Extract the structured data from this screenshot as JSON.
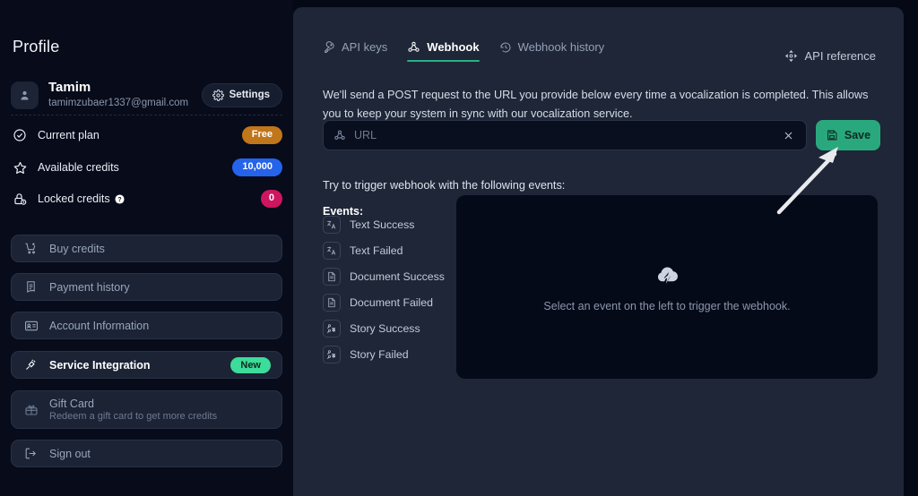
{
  "sidebar": {
    "title": "Profile",
    "user": {
      "name": "Tamim",
      "email": "tamimzubaer1337@gmail.com",
      "avatar_icon": "user-icon"
    },
    "settings_button": {
      "label": "Settings",
      "icon": "gear-icon"
    },
    "stats": [
      {
        "label": "Current plan",
        "icon": "check-circle-icon",
        "value": "Free",
        "badge_color": "#c0761a",
        "help": false
      },
      {
        "label": "Available credits",
        "icon": "star-icon",
        "value": "10,000",
        "badge_color": "#2563eb",
        "help": false
      },
      {
        "label": "Locked credits",
        "icon": "lock-clock-icon",
        "value": "0",
        "badge_color": "#cf1560",
        "help": true
      }
    ],
    "nav": [
      {
        "label": "Buy credits",
        "icon": "cart-plus-icon",
        "sub": "",
        "active": false,
        "badge": ""
      },
      {
        "label": "Payment history",
        "icon": "receipt-icon",
        "sub": "",
        "active": false,
        "badge": ""
      },
      {
        "label": "Account Information",
        "icon": "id-card-icon",
        "sub": "",
        "active": false,
        "badge": ""
      },
      {
        "label": "Service Integration",
        "icon": "plug-icon",
        "sub": "",
        "active": true,
        "badge": "New"
      },
      {
        "label": "Gift Card",
        "icon": "gift-icon",
        "sub": "Redeem a gift card to get more credits",
        "active": false,
        "badge": ""
      },
      {
        "label": "Sign out",
        "icon": "sign-out-icon",
        "sub": "",
        "active": false,
        "badge": ""
      }
    ]
  },
  "main": {
    "tabs": [
      {
        "label": "API keys",
        "icon": "key-icon",
        "active": false
      },
      {
        "label": "Webhook",
        "icon": "webhook-icon",
        "active": true
      },
      {
        "label": "Webhook history",
        "icon": "history-icon",
        "active": false
      }
    ],
    "api_reference": {
      "label": "API reference",
      "icon": "api-icon"
    },
    "description": "We'll send a POST request to the URL you provide below every time a vocalization is completed. This allows you to keep your system in sync with our vocalization service.",
    "url_field": {
      "placeholder": "URL",
      "value": "",
      "icon": "webhook-icon",
      "clear_icon": "close-icon"
    },
    "save_button": {
      "label": "Save",
      "icon": "save-disk-icon",
      "color": "#2aa87d"
    },
    "try_line": "Try to trigger webhook with the following events:",
    "events_label": "Events:",
    "events": [
      {
        "label": "Text Success",
        "icon": "translate-icon"
      },
      {
        "label": "Text Failed",
        "icon": "translate-icon"
      },
      {
        "label": "Document Success",
        "icon": "document-icon"
      },
      {
        "label": "Document Failed",
        "icon": "document-icon"
      },
      {
        "label": "Story Success",
        "icon": "story-users-icon"
      },
      {
        "label": "Story Failed",
        "icon": "story-users-icon"
      }
    ],
    "preview": {
      "icon": "cloud-lightning-icon",
      "text": "Select an event on the left to trigger the webhook."
    }
  },
  "annotation": {
    "arrow_icon": "pointer-arrow-icon",
    "points_to": "save-button"
  },
  "theme": {
    "page_bg": "#050915",
    "sidebar_bg": "#070b1a",
    "panel_bg": "#1e2637",
    "accent": "#29b083"
  }
}
